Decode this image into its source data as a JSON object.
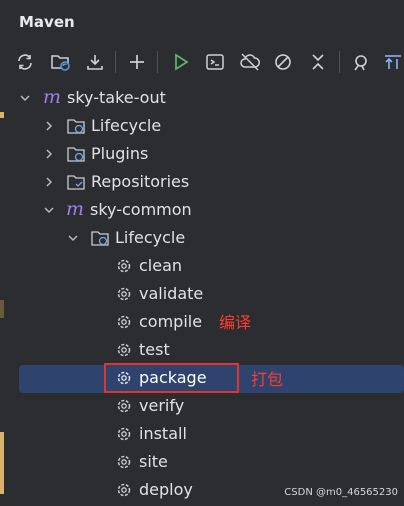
{
  "panel": {
    "title": "Maven"
  },
  "toolbar": {
    "buttons": [
      {
        "name": "reload-icon"
      },
      {
        "name": "generate-sources-icon"
      },
      {
        "name": "download-icon"
      },
      {
        "name": "add-icon"
      },
      {
        "name": "run-icon"
      },
      {
        "name": "execute-goal-icon"
      },
      {
        "name": "offline-icon"
      },
      {
        "name": "skip-tests-icon"
      },
      {
        "name": "collapse-icon"
      },
      {
        "name": "analyze-icon"
      },
      {
        "name": "sort-icon"
      }
    ]
  },
  "tree": {
    "root": "sky-take-out",
    "root_children": [
      "Lifecycle",
      "Plugins",
      "Repositories"
    ],
    "module": "sky-common",
    "module_lifecycle": "Lifecycle",
    "goals": [
      "clean",
      "validate",
      "compile",
      "test",
      "package",
      "verify",
      "install",
      "site",
      "deploy"
    ],
    "selected_goal": "package"
  },
  "annotations": {
    "compile_note": "编译",
    "package_note": "打包"
  },
  "watermark": "CSDN @m0_46565230",
  "colors": {
    "background": "#2b2d30",
    "selection": "#2e436e",
    "maven_icon": "#a67bf0",
    "run_icon": "#5fb865",
    "annotation_red": "#ff3b30"
  }
}
